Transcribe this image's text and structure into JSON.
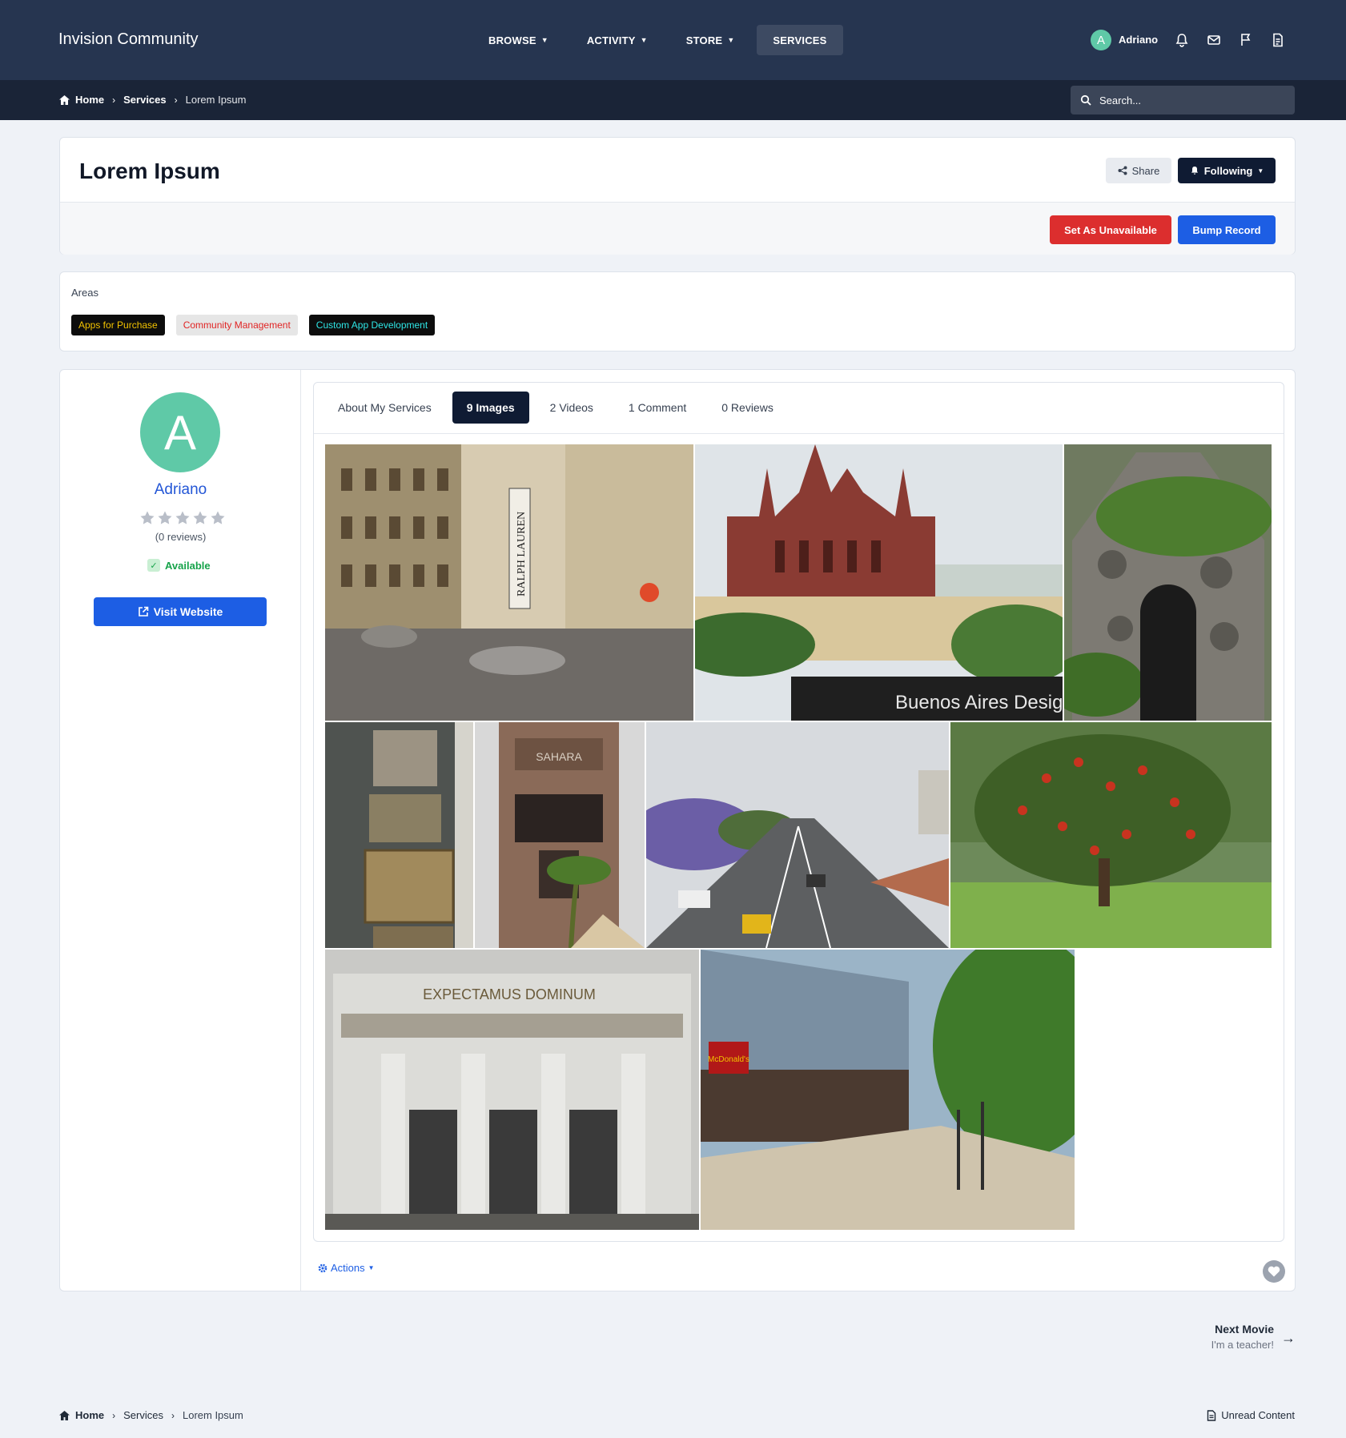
{
  "header": {
    "brand": "Invision Community",
    "nav": [
      {
        "label": "BROWSE",
        "caret": true
      },
      {
        "label": "ACTIVITY",
        "caret": true
      },
      {
        "label": "STORE",
        "caret": true
      },
      {
        "label": "SERVICES",
        "caret": false,
        "active": true
      }
    ],
    "user": {
      "initial": "A",
      "name": "Adriano"
    },
    "icons": [
      "bell-icon",
      "envelope-icon",
      "flag-icon",
      "document-icon"
    ]
  },
  "breadcrumb": {
    "home": "Home",
    "section": "Services",
    "current": "Lorem Ipsum"
  },
  "search": {
    "placeholder": "Search..."
  },
  "record": {
    "title": "Lorem Ipsum",
    "share_label": "Share",
    "following_label": "Following",
    "unavailable_label": "Set As Unavailable",
    "bump_label": "Bump Record"
  },
  "areas": {
    "label": "Areas",
    "tags": [
      {
        "label": "Apps for Purchase",
        "bg": "#0d0d0d",
        "fg": "#f2c200"
      },
      {
        "label": "Community Management",
        "bg": "#e6e6e6",
        "fg": "#e02424"
      },
      {
        "label": "Custom App Development",
        "bg": "#0d0d0d",
        "fg": "#2ee6e6"
      }
    ]
  },
  "profile": {
    "initial": "A",
    "name": "Adriano",
    "rating": 0,
    "reviews_text": "(0 reviews)",
    "status": "Available",
    "visit_label": "Visit Website"
  },
  "tabs": [
    {
      "label": "About My Services",
      "active": false
    },
    {
      "label": "9 Images",
      "active": true
    },
    {
      "label": "2 Videos",
      "active": false
    },
    {
      "label": "1 Comment",
      "active": false
    },
    {
      "label": "0 Reviews",
      "active": false
    }
  ],
  "gallery": {
    "photos": [
      {
        "name": "photo-street-buildings",
        "sign": "RALPH LAUREN"
      },
      {
        "name": "photo-red-church",
        "sign": "Buenos Aires Design:"
      },
      {
        "name": "photo-stone-grotto"
      },
      {
        "name": "photo-bronze-plaques"
      },
      {
        "name": "photo-stone-tower",
        "sign": "SAHARA"
      },
      {
        "name": "photo-avenue"
      },
      {
        "name": "photo-red-tree"
      },
      {
        "name": "photo-cemetery-gate",
        "sign": "EXPECTAMUS DOMINUM"
      },
      {
        "name": "photo-shopping-street",
        "sign": "McDonald's"
      }
    ]
  },
  "footer_actions": {
    "actions_label": "Actions"
  },
  "next": {
    "label": "Next Movie",
    "sub": "I'm a teacher!"
  },
  "unread_label": "Unread Content",
  "colors": {
    "header": "#263550",
    "subbar": "#1a2437",
    "accent": "#1d5ee4",
    "danger": "#dc2e2e",
    "dark": "#0f1b33",
    "avatar": "#5fc9a7"
  }
}
